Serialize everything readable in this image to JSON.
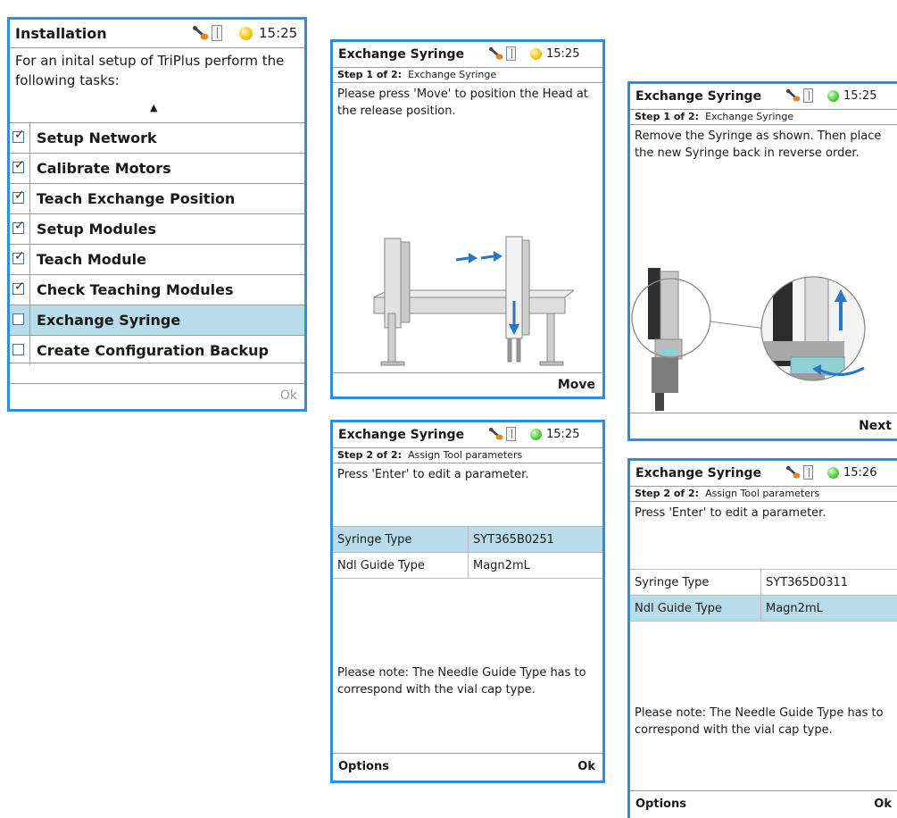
{
  "colors": {
    "frame": "#2f8de0",
    "selection": "#b8dce9",
    "status_yellow": "#f1c40f",
    "status_green": "#4fca3a"
  },
  "installation": {
    "title": "Installation",
    "time": "15:25",
    "status_color": "yellow",
    "intro": "For an inital setup of TriPlus perform the following tasks:",
    "scroll_indicator": "▲",
    "tasks": [
      {
        "label": "Setup Network",
        "checked": true
      },
      {
        "label": "Calibrate Motors",
        "checked": true
      },
      {
        "label": "Teach Exchange Position",
        "checked": true
      },
      {
        "label": "Setup Modules",
        "checked": true
      },
      {
        "label": "Teach Module",
        "checked": true
      },
      {
        "label": "Check Teaching Modules",
        "checked": true
      },
      {
        "label": "Exchange Syringe",
        "checked": false,
        "selected": true
      },
      {
        "label": "Create Configuration Backup",
        "checked": false
      }
    ],
    "right_softkey": "Ok"
  },
  "step1_move": {
    "title": "Exchange Syringe",
    "time": "15:25",
    "status_color": "yellow",
    "step_prefix": "Step 1 of 2:",
    "step_name": "Exchange Syringe",
    "message": "Please press 'Move' to position the Head at the release position.",
    "right_softkey": "Move"
  },
  "step1_remove": {
    "title": "Exchange Syringe",
    "time": "15:25",
    "status_color": "green",
    "step_prefix": "Step 1 of 2:",
    "step_name": "Exchange Syringe",
    "message": "Remove the Syringe as shown. Then place the new Syringe back in reverse order.",
    "right_softkey": "Next"
  },
  "step2_a": {
    "title": "Exchange Syringe",
    "time": "15:25",
    "status_color": "green",
    "step_prefix": "Step 2 of 2:",
    "step_name": "Assign Tool parameters",
    "message": "Press 'Enter' to edit a parameter.",
    "params": [
      {
        "name": "Syringe Type",
        "value": "SYT365B0251",
        "selected": true
      },
      {
        "name": "Ndl Guide Type",
        "value": "Magn2mL",
        "selected": false
      }
    ],
    "note": "Please note: The Needle Guide Type has to correspond with the vial cap type.",
    "left_softkey": "Options",
    "right_softkey": "Ok"
  },
  "step2_b": {
    "title": "Exchange Syringe",
    "time": "15:26",
    "status_color": "green",
    "step_prefix": "Step 2 of 2:",
    "step_name": "Assign Tool parameters",
    "message": "Press 'Enter' to edit a parameter.",
    "params": [
      {
        "name": "Syringe Type",
        "value": "SYT365D0311",
        "selected": false
      },
      {
        "name": "Ndl Guide Type",
        "value": "Magn2mL",
        "selected": true
      }
    ],
    "note": "Please note: The Needle Guide Type has to correspond with the vial cap type.",
    "left_softkey": "Options",
    "right_softkey": "Ok"
  }
}
